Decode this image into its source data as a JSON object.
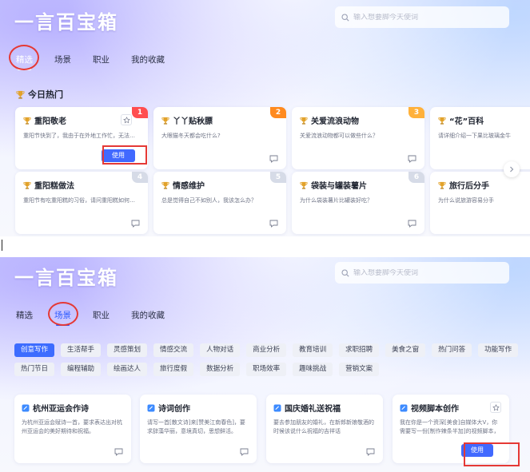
{
  "app": {
    "title": "一言百宝箱"
  },
  "search": {
    "placeholder": "输入想要脚今天使词"
  },
  "tabs": [
    "精选",
    "场景",
    "职业",
    "我的收藏"
  ],
  "hot": {
    "title": "今日热门"
  },
  "hot_cards": [
    {
      "title": "重阳敬老",
      "desc": "重阳节快到了，我由于在外地工作忙，无法回…",
      "rank": "1",
      "use_label": "使用"
    },
    {
      "title": "丫丫贴秋膘",
      "desc": "大眼猫冬天都会吃什么?",
      "rank": "2"
    },
    {
      "title": "关爱流浪动物",
      "desc": "关爱流浪动物都可以做些什么？",
      "rank": "3"
    },
    {
      "title": "“花”百科",
      "desc": "请详细介绍一下果比玻璃金牛",
      "rank": ""
    },
    {
      "title": "重阳糕做法",
      "desc": "重阳节有吃重阳糕的习俗，请问重阳糕如何…",
      "rank": "4"
    },
    {
      "title": "情感维护",
      "desc": "总是觉得自己不如别人，我该怎么办？",
      "rank": "5"
    },
    {
      "title": "袋装与罐装薯片",
      "desc": "为什么袋装薯片比罐装好吃？",
      "rank": "6"
    },
    {
      "title": "旅行后分手",
      "desc": "为什么说旅游容易分手",
      "rank": ""
    }
  ],
  "chips": [
    "创意写作",
    "生活帮手",
    "灵感策划",
    "情感交流",
    "人物对话",
    "商业分析",
    "教育培训",
    "求职招聘",
    "美食之窗",
    "热门问答",
    "功能写作",
    "热门节日",
    "编程辅助",
    "绘画达人",
    "旅行度假",
    "数据分析",
    "职场效率",
    "趣味挑战",
    "营销文案"
  ],
  "scene_cards": [
    {
      "title": "杭州亚运会作诗",
      "desc": "为杭州亚运会赋诗一首，要求表达出对杭州亚运会的美好期待和祝福。"
    },
    {
      "title": "诗词创作",
      "desc_a": "请写一首[散文诗]来[赞美江南春色]，要求辞藻华丽，意境真切，思想鲜活。"
    },
    {
      "title": "国庆婚礼送祝福",
      "desc": "要去参加朋友的婚礼，在新郎新娘敬酒的时候该说什么祝福的吉祥话"
    },
    {
      "title": "视频脚本创作",
      "desc": "我在你是一个资深[美食]自媒体大V，你需要写一份[制作辣条半加]的视频脚本，要求表…",
      "use_label": "使用"
    }
  ],
  "colors": {
    "accent": "#3d6cff",
    "highlight_box": "#e53935"
  }
}
